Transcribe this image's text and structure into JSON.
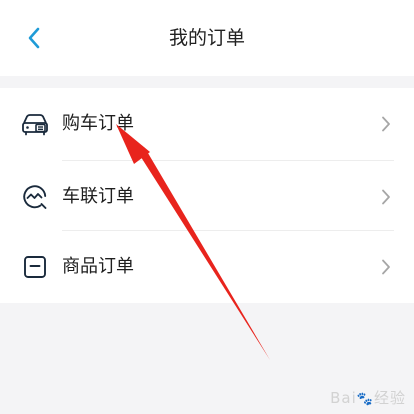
{
  "header": {
    "title": "我的订单"
  },
  "orders": [
    {
      "label": "购车订单",
      "icon": "car-order-icon"
    },
    {
      "label": "车联订单",
      "icon": "connected-car-icon"
    },
    {
      "label": "商品订单",
      "icon": "product-order-icon"
    }
  ],
  "colors": {
    "accent": "#1f9bd7",
    "icon": "#1a2a3c",
    "chevron": "#a6a6a6",
    "annotation_arrow": "#e8241d"
  },
  "watermark": {
    "text": "Bai 经验"
  }
}
